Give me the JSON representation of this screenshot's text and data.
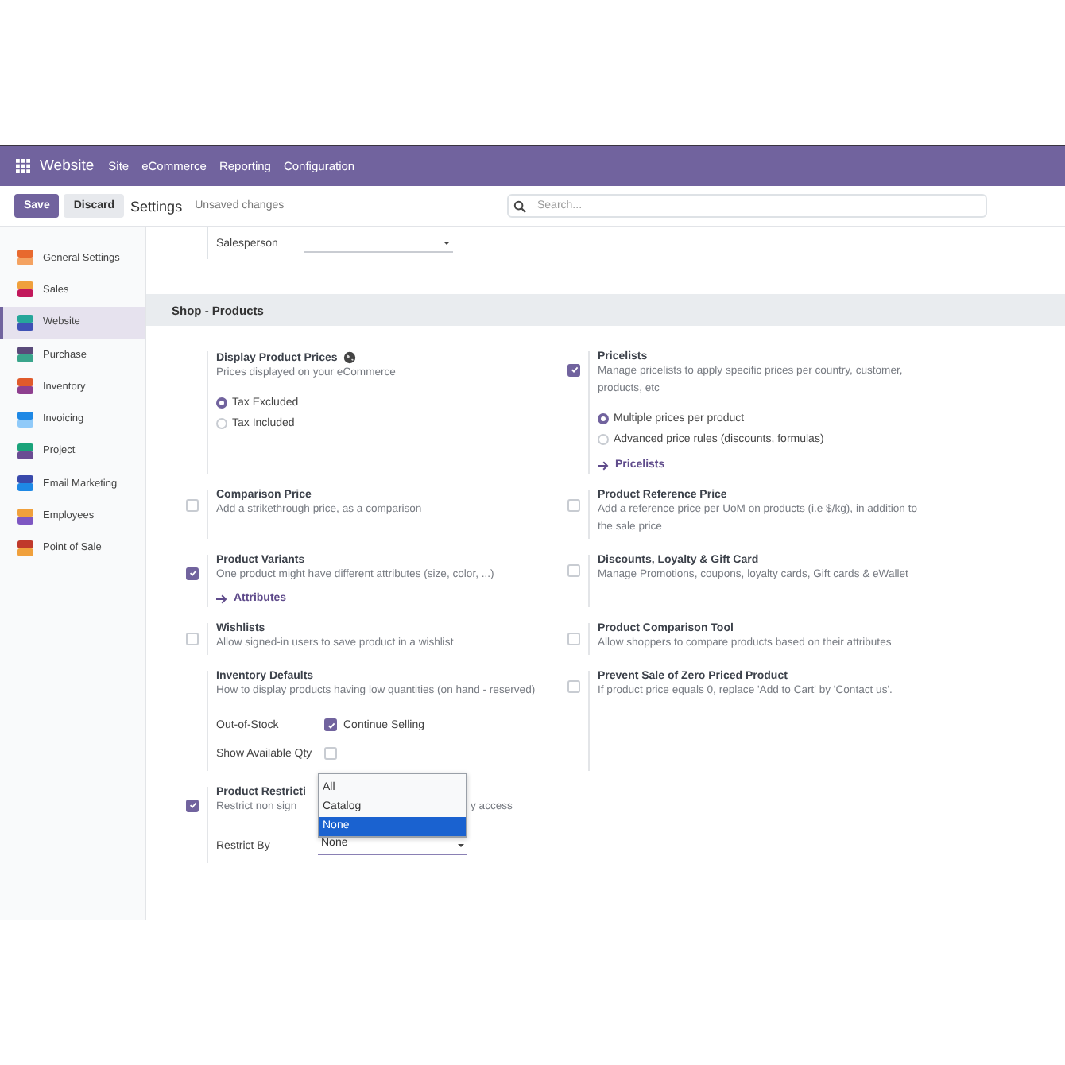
{
  "navbar": {
    "app_name": "Website",
    "menu": [
      "Site",
      "eCommerce",
      "Reporting",
      "Configuration"
    ]
  },
  "control_bar": {
    "buttons": [
      {
        "label": "Save",
        "kind": "primary"
      },
      {
        "label": "Discard",
        "kind": "secondary"
      }
    ],
    "title": "Settings",
    "status": "Unsaved changes",
    "search": {
      "placeholder": "Search..."
    }
  },
  "sidebar": {
    "items": [
      {
        "label": "General Settings",
        "selected": false
      },
      {
        "label": "Sales",
        "selected": false
      },
      {
        "label": "Website",
        "selected": true
      },
      {
        "label": "Purchase",
        "selected": false
      },
      {
        "label": "Inventory",
        "selected": false
      },
      {
        "label": "Invoicing",
        "selected": false
      },
      {
        "label": "Project",
        "selected": false
      },
      {
        "label": "Email Marketing",
        "selected": false
      },
      {
        "label": "Employees",
        "selected": false
      },
      {
        "label": "Point of Sale",
        "selected": false
      }
    ]
  },
  "salesperson": {
    "label": "Salesperson"
  },
  "section": {
    "title": "Shop - Products"
  },
  "settings": [
    {
      "kind": "plain",
      "title": "Display Product Prices",
      "globe": true,
      "description": "Prices displayed on your eCommerce",
      "options": [
        {
          "label": "Tax Excluded",
          "selected": true
        },
        {
          "label": "Tax Included",
          "selected": false
        }
      ]
    },
    {
      "kind": "checkbox",
      "checked": true,
      "title": "Pricelists",
      "description": "Manage pricelists to apply specific prices per country, customer, products, etc",
      "options": [
        {
          "label": "Multiple prices per product",
          "selected": true
        },
        {
          "label": "Advanced price rules (discounts, formulas)",
          "selected": false
        }
      ],
      "link": "Pricelists"
    },
    {
      "kind": "checkbox",
      "checked": false,
      "title": "Comparison Price",
      "description": "Add a strikethrough price, as a comparison"
    },
    {
      "kind": "checkbox",
      "checked": false,
      "title": "Product Reference Price",
      "description": "Add a reference price per UoM on products (i.e $/kg), in addition to the sale price"
    },
    {
      "kind": "checkbox",
      "checked": true,
      "title": "Product Variants",
      "description": "One product might have different attributes (size, color, ...)",
      "link": "Attributes"
    },
    {
      "kind": "checkbox",
      "checked": false,
      "title": "Discounts, Loyalty & Gift Card",
      "description": "Manage Promotions, coupons, loyalty cards, Gift cards & eWallet"
    },
    {
      "kind": "checkbox",
      "checked": false,
      "title": "Wishlists",
      "description": "Allow signed-in users to save product in a wishlist"
    },
    {
      "kind": "checkbox",
      "checked": false,
      "title": "Product Comparison Tool",
      "description": "Allow shoppers to compare products based on their attributes"
    },
    {
      "kind": "plain",
      "title": "Inventory Defaults",
      "description": "How to display products having low quantities (on hand - reserved)",
      "fields": [
        {
          "label": "Out-of-Stock",
          "checked": true,
          "text": "Continue Selling"
        },
        {
          "label": "Show Available Qty",
          "checked": false
        }
      ]
    },
    {
      "kind": "checkbox",
      "checked": false,
      "title": "Prevent Sale of Zero Priced Product",
      "description": "If product price equals 0, replace 'Add to Cart' by 'Contact us'."
    },
    {
      "kind": "restriction",
      "checked": true,
      "title": "Product Restricti",
      "description_start": "Restrict non sign",
      "description_end": "y access",
      "select": {
        "label": "Restrict By",
        "value": "None",
        "options": [
          {
            "label": "All",
            "selected": false
          },
          {
            "label": "Catalog",
            "selected": false
          },
          {
            "label": "None",
            "selected": true
          }
        ]
      }
    }
  ]
}
